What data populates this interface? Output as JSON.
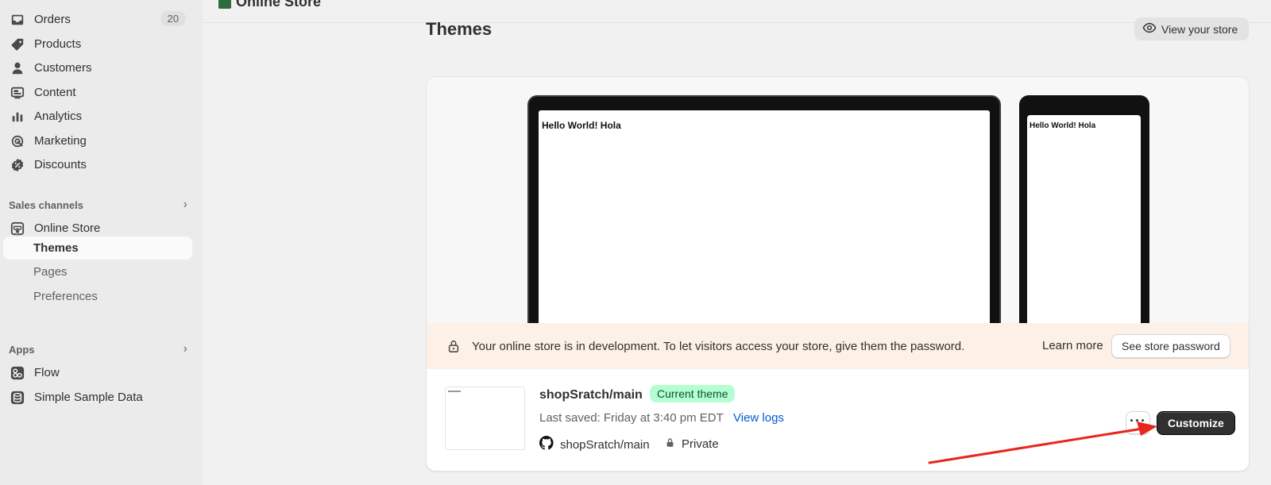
{
  "sidebar": {
    "items": [
      {
        "label": "Orders",
        "icon": "inbox-icon",
        "badge": "20"
      },
      {
        "label": "Products",
        "icon": "tag-icon"
      },
      {
        "label": "Customers",
        "icon": "person-icon"
      },
      {
        "label": "Content",
        "icon": "content-icon"
      },
      {
        "label": "Analytics",
        "icon": "bar-chart-icon"
      },
      {
        "label": "Marketing",
        "icon": "target-icon"
      },
      {
        "label": "Discounts",
        "icon": "discount-icon"
      }
    ],
    "sales_channels": {
      "heading": "Sales channels",
      "online_store": "Online Store",
      "sub_items": [
        "Themes",
        "Pages",
        "Preferences"
      ],
      "active": "Themes"
    },
    "apps": {
      "heading": "Apps",
      "items": [
        "Flow",
        "Simple Sample Data"
      ]
    }
  },
  "topbar": {
    "title": "Online Store"
  },
  "page": {
    "title": "Themes",
    "view_store_label": "View your store"
  },
  "preview": {
    "desktop_text": "Hello World! Hola",
    "mobile_text": "Hello World! Hola"
  },
  "banner": {
    "message": "Your online store is in development. To let visitors access your store, give them the password.",
    "learn_more": "Learn more",
    "see_password": "See store password"
  },
  "theme": {
    "name": "shopSratch/main",
    "badge": "Current theme",
    "last_saved": "Last saved: Friday at 3:40 pm EDT",
    "view_logs": "View logs",
    "repo": "shopSratch/main",
    "visibility": "Private",
    "more_label": "···",
    "customize_label": "Customize"
  },
  "colors": {
    "accent_dark": "#303030",
    "link": "#005bd3",
    "badge_green": "#b4fed2",
    "banner_bg": "#fdf0e6",
    "annotation_arrow": "#e8261c"
  }
}
